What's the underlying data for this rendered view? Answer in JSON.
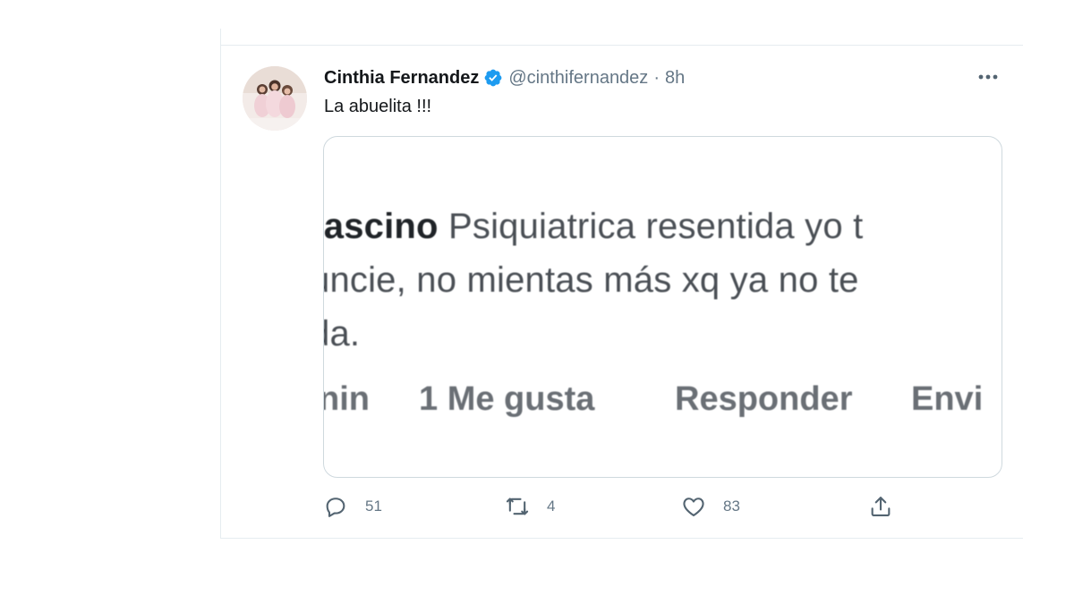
{
  "tweet": {
    "author": {
      "display_name": "Cinthia Fernandez",
      "handle": "@cinthifernandez",
      "separator": "·",
      "time": "8h",
      "verified": true,
      "avatar_icon": "profile-photo"
    },
    "text": "La abuelita !!!",
    "more_icon": "more-horizontal-icon",
    "media": {
      "line1_bold": "rascino",
      "line1_rest": " Psiquiatrica resentida yo t",
      "line2": "uncie, no mientas más xq ya no te",
      "line3": "da.",
      "action_time": "nin",
      "action_like": "1 Me gusta",
      "action_reply": "Responder",
      "action_send": "Envi"
    },
    "stats": {
      "replies": "51",
      "retweets": "4",
      "likes": "83"
    }
  },
  "colors": {
    "text_primary": "#14171a",
    "text_secondary": "#657786",
    "verified_blue": "#1d9bf0",
    "border": "#e6ecf0"
  }
}
